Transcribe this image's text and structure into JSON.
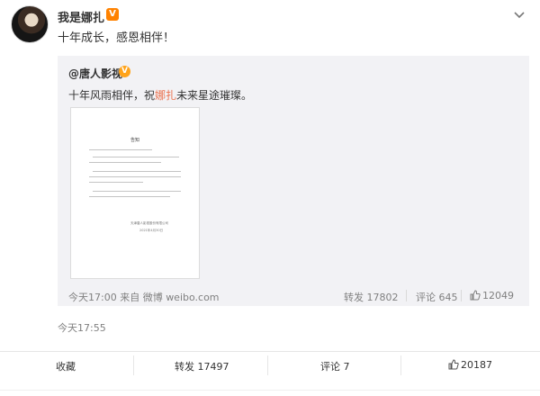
{
  "post": {
    "user_name": "我是娜扎",
    "verified_badge": "V",
    "text": "十年成长，感恩相伴！",
    "timestamp": "今天17:55"
  },
  "retweet": {
    "author": "@唐人影视",
    "verified_badge": "V",
    "text_before": "十年风雨相伴，祝",
    "text_highlight": "娜扎",
    "text_after": "未来星途璀璨。",
    "highlight_color": "#eb7350",
    "meta": "今天17:00 来自 微博 weibo.com",
    "repost": "转发 17802",
    "comment": "评论 645",
    "like": "12049",
    "document": {
      "title": "告知",
      "company": "天津唐人影视股份有限公司",
      "date": "2021年4月30日"
    }
  },
  "toolbar": {
    "favorite": "收藏",
    "repost": "转发 17497",
    "comment": "评论 7",
    "like": "20187"
  },
  "icons": {
    "more": "chevron-down-icon",
    "like": "thumbs-up-icon",
    "comment": "comment-icon",
    "verified": "verified-badge-icon"
  },
  "colors": {
    "verified_orange": "#ff8200",
    "meta_gray": "#808080",
    "retweet_bg": "#f2f2f5"
  }
}
